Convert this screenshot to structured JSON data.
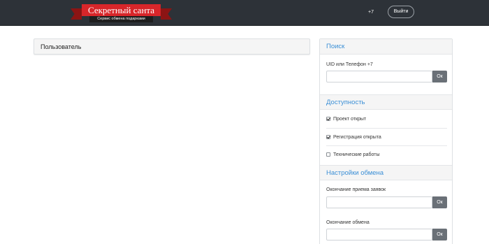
{
  "header": {
    "logo_title": "Секретный санта",
    "logo_subtitle": "Сервис обмена подарками",
    "nav_link": "+7",
    "logout_label": "Выйти"
  },
  "user_panel": {
    "title": "Пользователь"
  },
  "search": {
    "title": "Поиск",
    "field_label": "UID или Телефон +7",
    "value": "",
    "ok_label": "Ок"
  },
  "availability": {
    "title": "Доступность",
    "items": [
      {
        "label": "Проект открыт",
        "checked": true
      },
      {
        "label": "Регистрация открыта",
        "checked": true
      },
      {
        "label": "Технические работы",
        "checked": false
      }
    ]
  },
  "exchange_settings": {
    "title": "Настройки обмена",
    "fields": [
      {
        "label": "Окончание приема заявок",
        "value": "",
        "ok_label": "Ок"
      },
      {
        "label": "Окончание обмена",
        "value": "",
        "ok_label": "Ок"
      }
    ]
  },
  "colors": {
    "navbar": "#2d3238",
    "ribbon_red": "#d8262a",
    "section_title": "#3b8fd6",
    "ok_button": "#6a7077"
  }
}
